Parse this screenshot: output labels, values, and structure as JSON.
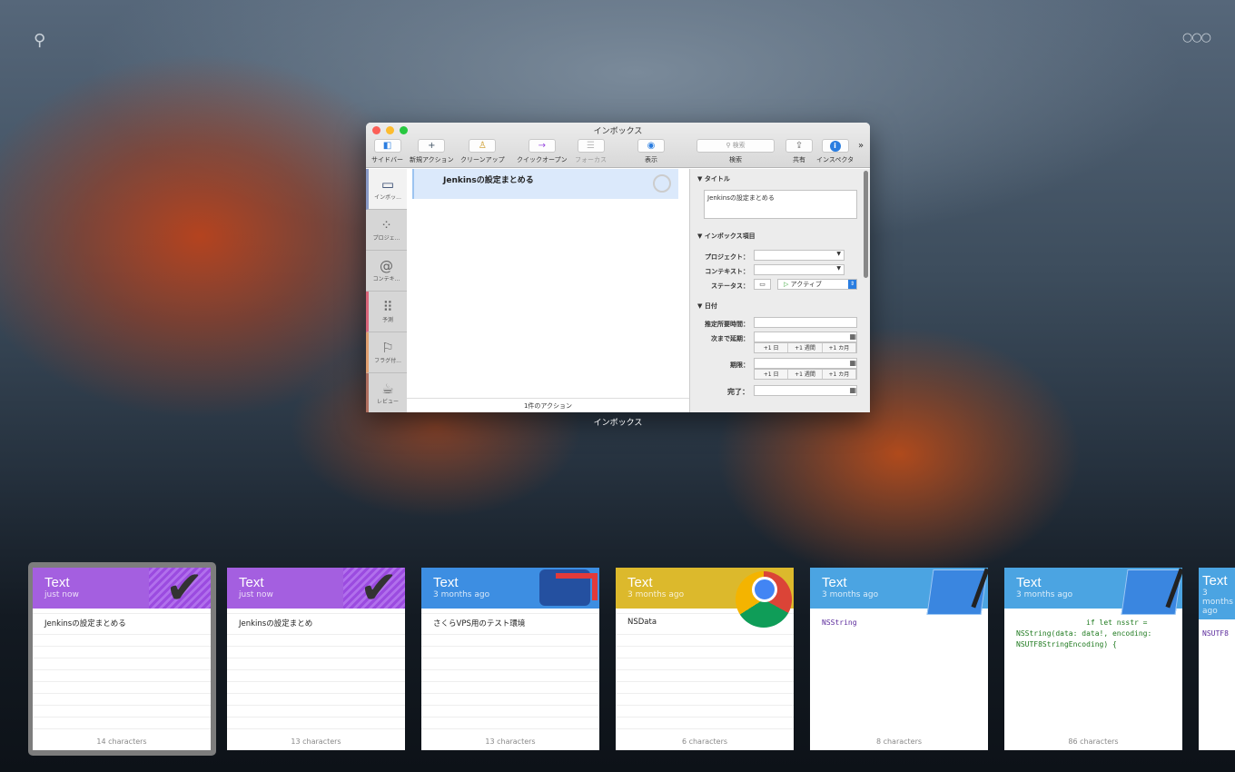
{
  "top": {
    "search_icon": "search-icon",
    "more_icon": "more-icon"
  },
  "window": {
    "title": "インボックス",
    "label": "インボックス",
    "toolbar": [
      {
        "label": "サイドバー",
        "glyph": "◧"
      },
      {
        "label": "新規アクション",
        "glyph": "+"
      },
      {
        "label": "クリーンアップ",
        "glyph": "♙"
      },
      {
        "label": "クイックオープン",
        "glyph": "→"
      },
      {
        "label": "フォーカス",
        "glyph": "☰"
      },
      {
        "label": "表示",
        "glyph": "◉"
      },
      {
        "label": "検索",
        "placeholder": "検索"
      },
      {
        "label": "共有",
        "glyph": "⇪"
      },
      {
        "label": "インスペクタ",
        "glyph": "i"
      }
    ],
    "sidebar": [
      {
        "label": "インボッ...",
        "glyph": "▭"
      },
      {
        "label": "プロジェ...",
        "glyph": "⁘"
      },
      {
        "label": "コンテキ...",
        "glyph": "@"
      },
      {
        "label": "予測",
        "glyph": "⠿"
      },
      {
        "label": "フラグ付...",
        "glyph": "⚐"
      },
      {
        "label": "レビュー",
        "glyph": "☕"
      }
    ],
    "task": "Jenkinsの設定まとめる",
    "footer": "1件のアクション",
    "inspector": {
      "title_section": "タイトル",
      "title_value": "Jenkinsの設定まとめる",
      "inbox_section": "インボックス項目",
      "project": "プロジェクト：",
      "context": "コンテキスト：",
      "status": "ステータス：",
      "status_value": "アクティブ",
      "date_section": "日付",
      "estimate": "推定所要時間：",
      "defer": "次まで延期：",
      "due": "期限：",
      "complete": "完了：",
      "d1": "+1 日",
      "w1": "+1 週間",
      "m1": "+1 カ月"
    }
  },
  "cards": [
    {
      "type": "Text",
      "time": "just now",
      "content": "Jenkinsの設定まとめる",
      "count": "14 characters",
      "color": "#a45fe0"
    },
    {
      "type": "Text",
      "time": "just now",
      "content": "Jenkinsの設定まとめ",
      "count": "13 characters",
      "color": "#a45fe0"
    },
    {
      "type": "Text",
      "time": "3 months ago",
      "content": "さくらVPS用のテスト環境",
      "count": "13 characters",
      "color": "#3d8ee2"
    },
    {
      "type": "Text",
      "time": "3 months ago",
      "content": "NSData",
      "count": "6 characters",
      "color": "#dcb92c"
    },
    {
      "type": "Text",
      "time": "3 months ago",
      "content": "NSString",
      "count": "8 characters",
      "color": "#4ba4e2"
    },
    {
      "type": "Text",
      "time": "3 months ago",
      "content": "                if let nsstr = NSString(data: data!, encoding: NSUTF8StringEncoding) {",
      "count": "86 characters",
      "color": "#4ba4e2"
    },
    {
      "type": "Text",
      "time": "3 months ago",
      "content": "NSUTF8",
      "count": "",
      "color": "#4ba4e2"
    }
  ]
}
